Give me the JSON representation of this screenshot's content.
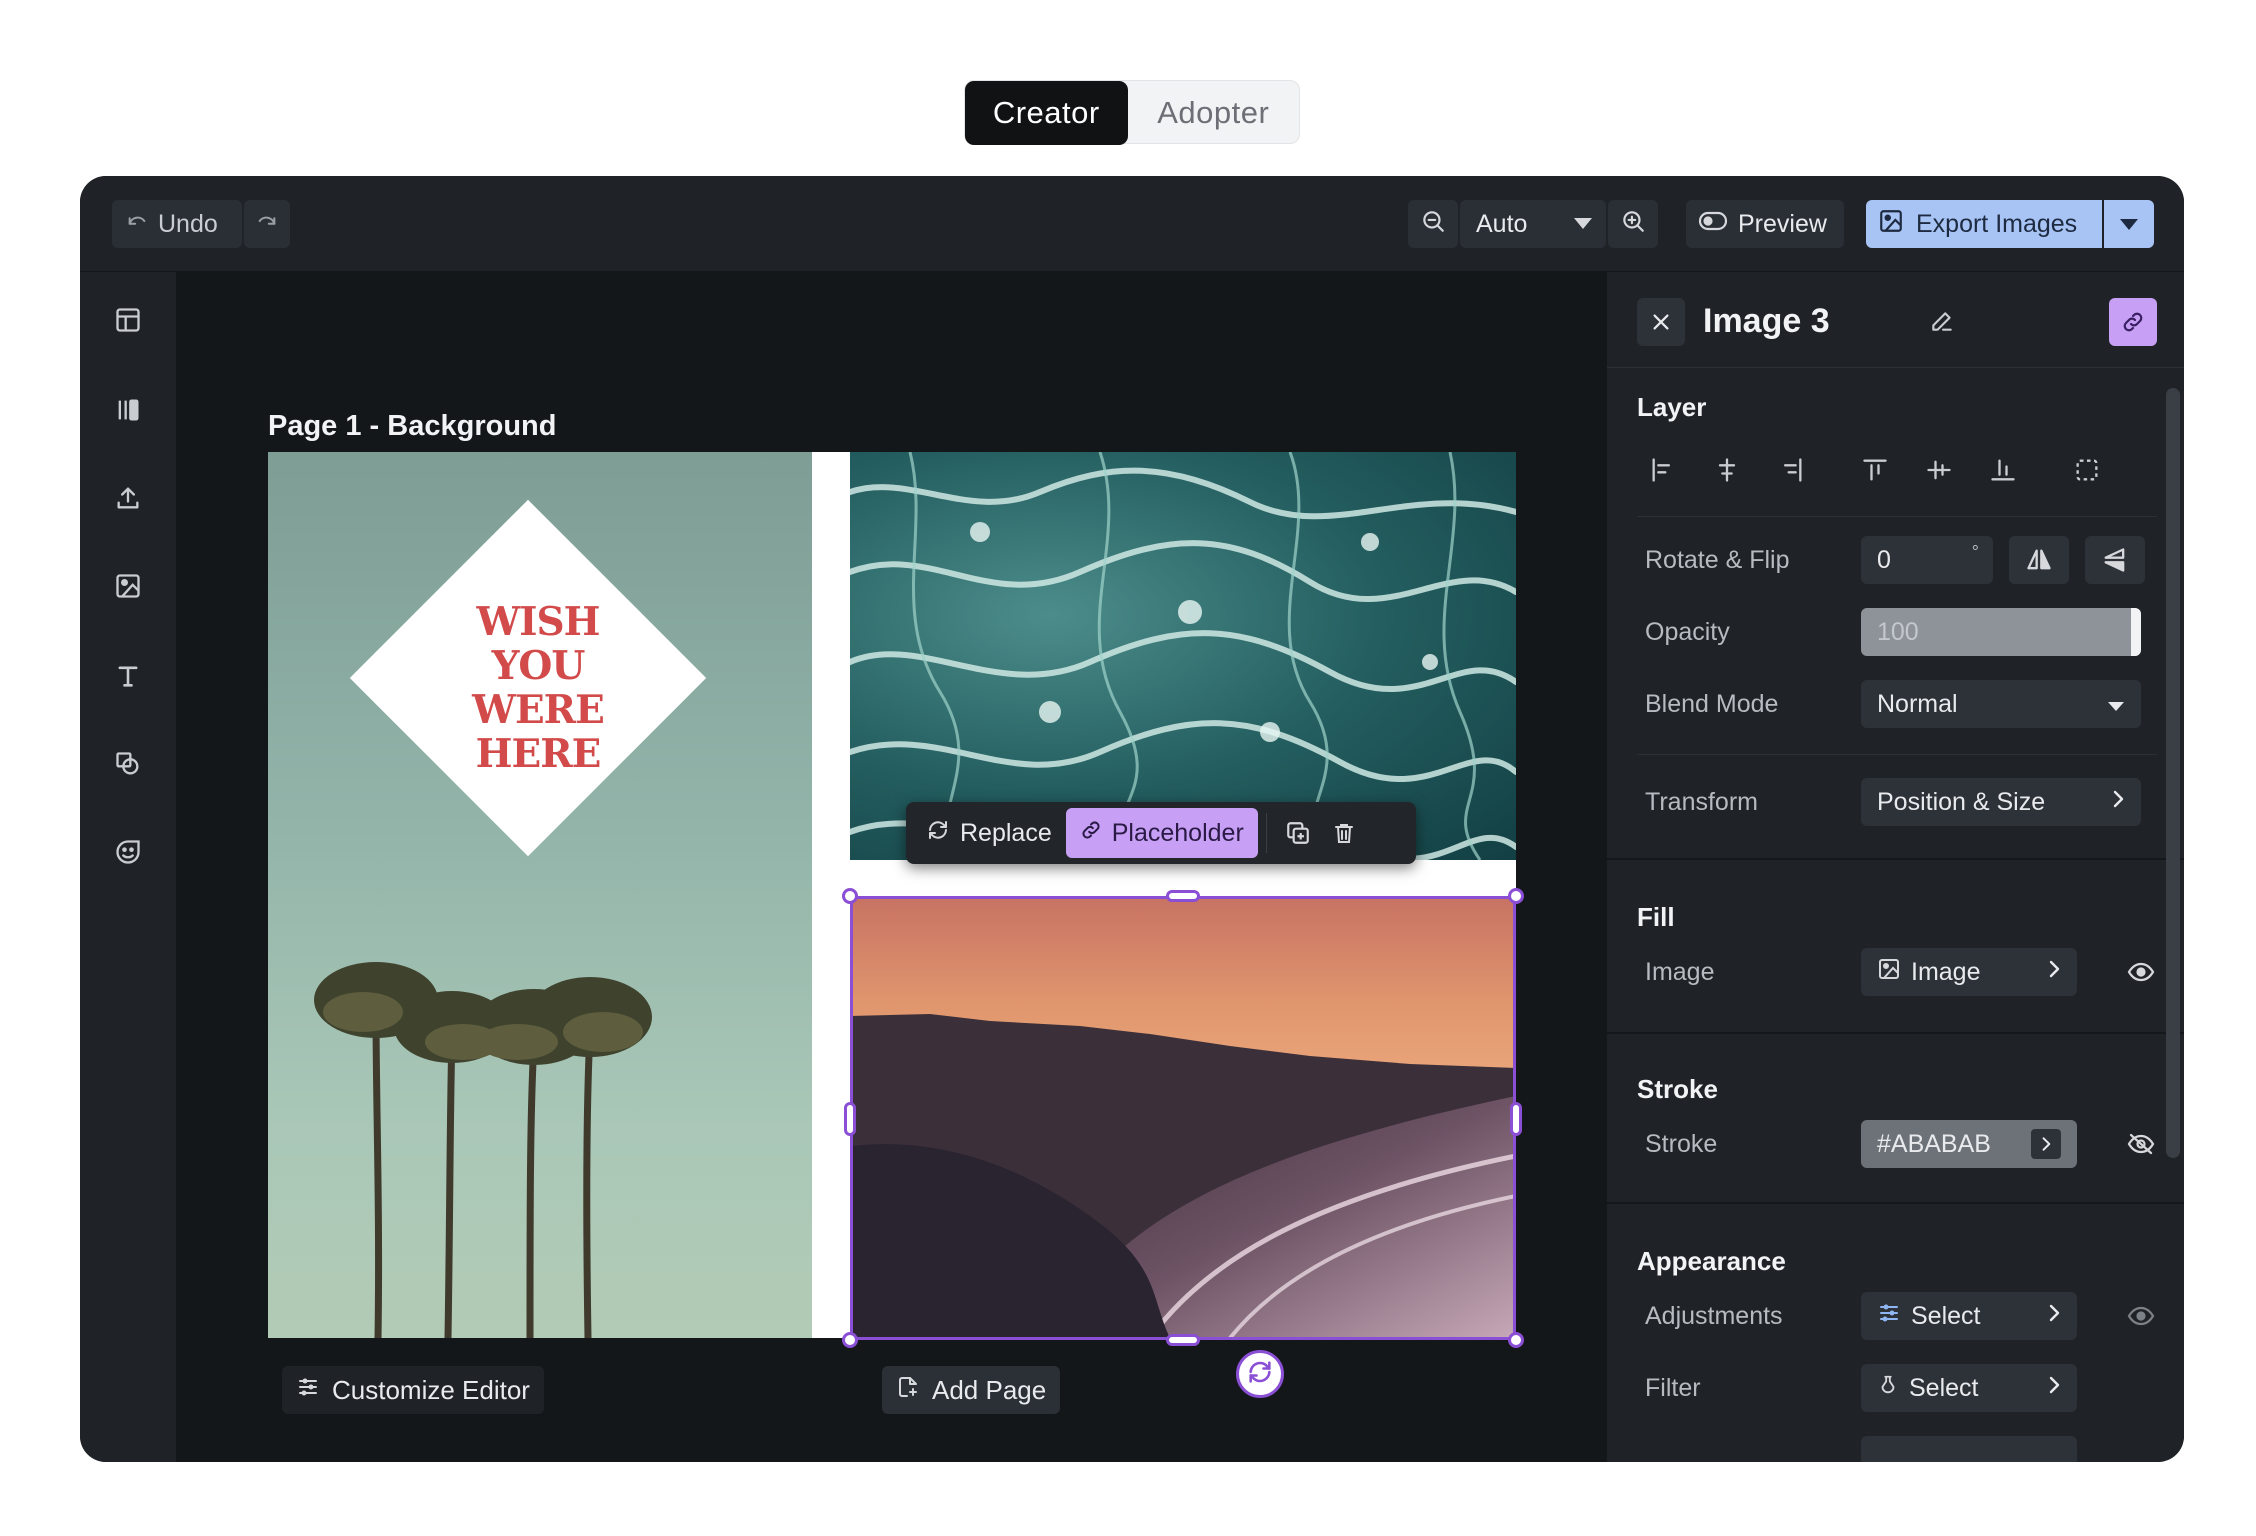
{
  "mode_toggle": {
    "creator": "Creator",
    "adopter": "Adopter",
    "active": "Creator"
  },
  "toolbar": {
    "undo_label": "Undo",
    "zoom_value": "Auto",
    "preview_label": "Preview",
    "export_label": "Export Images"
  },
  "canvas": {
    "page_label": "Page 1 - Background",
    "card_text": [
      "WISH",
      "YOU",
      "WERE",
      "HERE"
    ],
    "float_toolbar": {
      "replace": "Replace",
      "placeholder": "Placeholder"
    },
    "customize_label": "Customize Editor",
    "add_page_label": "Add Page"
  },
  "panel": {
    "title": "Image 3",
    "layer": {
      "section": "Layer",
      "rotate_label": "Rotate & Flip",
      "rotate_value": "0",
      "degree_symbol": "°",
      "opacity_label": "Opacity",
      "opacity_value": "100",
      "blend_label": "Blend Mode",
      "blend_value": "Normal",
      "transform_label": "Transform",
      "transform_value": "Position & Size"
    },
    "fill": {
      "section": "Fill",
      "image_label": "Image",
      "image_value": "Image"
    },
    "stroke": {
      "section": "Stroke",
      "stroke_label": "Stroke",
      "stroke_value": "#ABABAB"
    },
    "appearance": {
      "section": "Appearance",
      "adjustments_label": "Adjustments",
      "adjustments_value": "Select",
      "filter_label": "Filter",
      "filter_value": "Select"
    }
  },
  "colors": {
    "accent_purple": "#8b4fd6",
    "placeholder_bg": "#c7a0f5",
    "export_bg": "#a8c4f5",
    "app_bg": "#1f2327",
    "canvas_bg": "#14171a",
    "card_text": "#d24a4a"
  }
}
